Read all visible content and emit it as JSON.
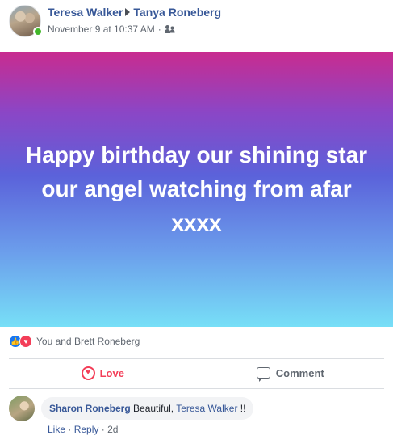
{
  "post": {
    "author": "Teresa Walker",
    "target": "Tanya Roneberg",
    "timestamp": "November 9 at 10:37 AM",
    "separator": "·",
    "audience_icon": "friends-icon",
    "banner_text": "Happy birthday our shining star our angel watching from afar xxxx",
    "banner_colors": {
      "top": "#c92b8f",
      "middle": "#5b62da",
      "bottom": "#77dff7"
    }
  },
  "reactions": {
    "icons": [
      "like-icon",
      "love-icon"
    ],
    "summary": "You and Brett Roneberg"
  },
  "actions": {
    "love_label": "Love",
    "comment_label": "Comment"
  },
  "comment": {
    "author": "Sharon Roneberg",
    "text": "Beautiful,",
    "mention": "Teresa Walker",
    "suffix": "!!",
    "like_label": "Like",
    "reply_label": "Reply",
    "age": "2d",
    "sep": "·"
  },
  "colors": {
    "link_blue": "#385898",
    "love_red": "#f33e58",
    "like_blue": "#1877f2",
    "online_green": "#42b72a"
  }
}
